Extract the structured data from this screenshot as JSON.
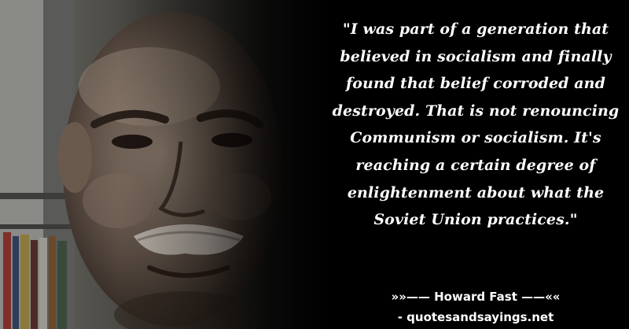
{
  "quote": {
    "text": "\"I was part of a generation that believed in socialism and finally found that belief corroded and destroyed. That is not renouncing Communism or socialism. It's reaching a certain degree of enlightenment about what the Soviet Union practices.\""
  },
  "attribution": {
    "author_line": "»»—— Howard Fast ——««"
  },
  "footer": {
    "site": "- quotesandsayings.net"
  },
  "colors": {
    "background": "#000000",
    "text": "#ffffff"
  }
}
